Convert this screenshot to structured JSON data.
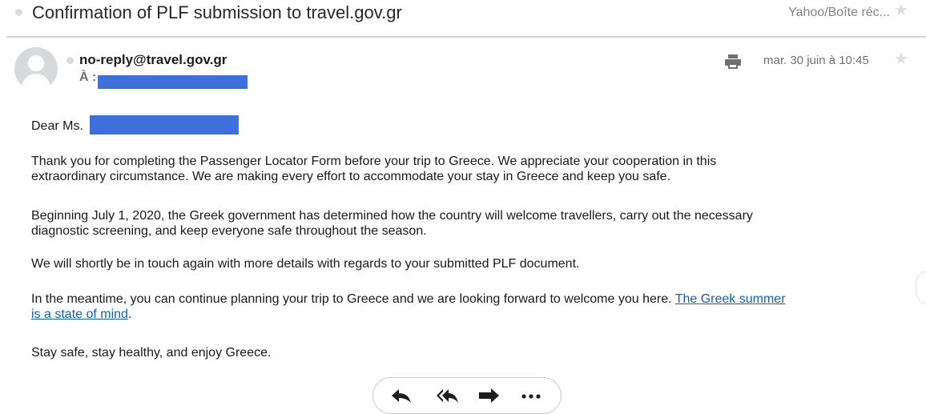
{
  "header": {
    "subject": "Confirmation of PLF submission to travel.gov.gr",
    "folder": "Yahoo/Boîte réc..."
  },
  "message": {
    "sender": "no-reply@travel.gov.gr",
    "to_label": "À :",
    "date": "mar. 30 juin à 10:45"
  },
  "body": {
    "greeting": "Dear Ms.",
    "p1": [
      "Thank you for completing the Passenger Locator Form before your trip to Greece. We appreciate your cooperation in this",
      "extraordinary circumstance. We are making every effort to accommodate your stay in Greece and keep you safe."
    ],
    "p2": [
      "Beginning July 1, 2020, the Greek government has determined how the country will welcome travellers, carry out the necessary",
      "diagnostic screening, and keep everyone safe throughout the season."
    ],
    "p3": "We will shortly be in touch again with more details with regards to your submitted PLF document.",
    "p4_text": "In the meantime, you can continue planning your trip to Greece and we are looking forward to welcome you here. ",
    "p4_link_1": "The Greek summer",
    "p4_link_2": "is a state of mind",
    "p4_end": ".",
    "p5": "Stay safe, stay healthy, and enjoy Greece."
  },
  "icons": {
    "star": "star-icon",
    "print": "print-icon",
    "reply": "reply-icon",
    "reply_all": "reply-all-icon",
    "forward": "forward-icon",
    "more": "more-icon"
  },
  "colors": {
    "redaction": "#3e70dc",
    "link": "#0b5ed7"
  }
}
